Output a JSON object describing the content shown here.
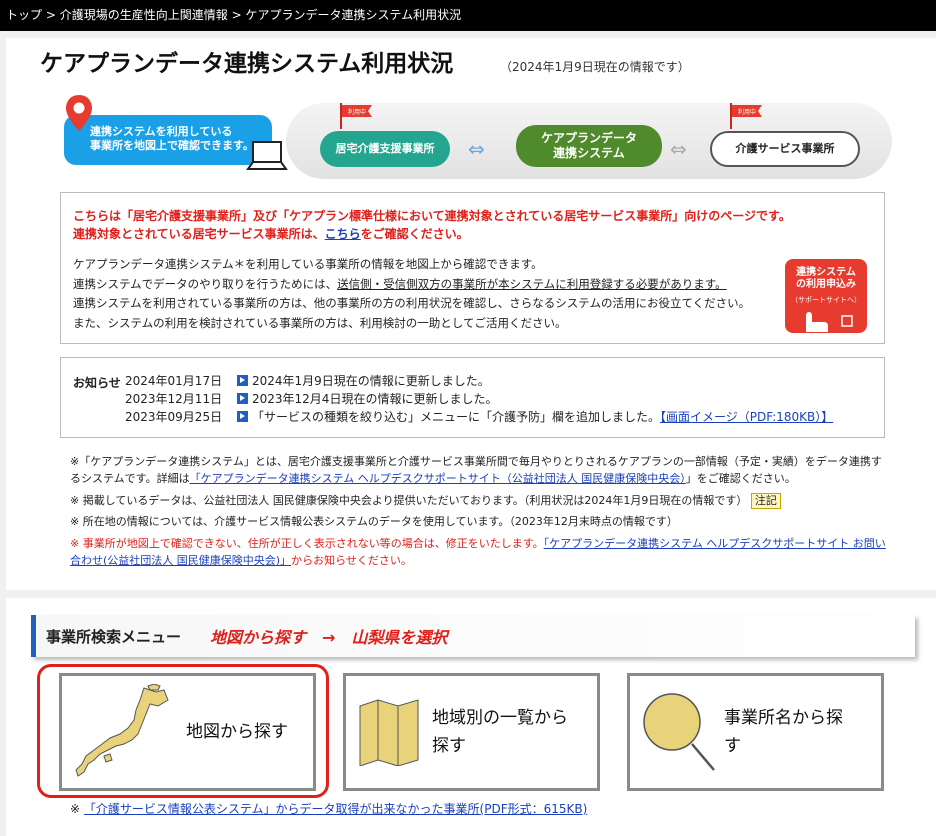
{
  "breadcrumb": {
    "items": [
      "トップ",
      "介護現場の生産性向上関連情報",
      "ケアプランデータ連携システム利用状況"
    ],
    "sep": ">"
  },
  "page": {
    "title": "ケアプランデータ連携システム利用状況",
    "as_of": "（2024年1月9日現在の情報です）"
  },
  "hero": {
    "map_text_line1": "連携システムを利用している",
    "map_text_line2": "事業所を地図上で確認できます。",
    "flag_label": "利用中",
    "node1": "居宅介護支援事業所",
    "node2_line1": "ケアプランデータ",
    "node2_line2": "連携システム",
    "node3": "介護サービス事業所",
    "arrow": "⇔"
  },
  "info": {
    "red_line1": "こちらは「居宅介護支援事業所」及び「ケアプラン標準仕様において連携対象とされている居宅サービス事業所」向けのページです。",
    "red_line2_pre": "連携対象とされている居宅サービス事業所は、",
    "red_line2_link": "こちら",
    "red_line2_post": "をご確認ください。",
    "desc1": "ケアプランデータ連携システム＊を利用している事業所の情報を地図上から確認できます。",
    "desc2_pre": "連携システムでデータのやり取りを行うためには、",
    "desc2_ul": "送信側・受信側双方の事業所が本システムに利用登録する必要があります。",
    "desc3": "連携システムを利用されている事業所の方は、他の事業所の方の利用状況を確認し、さらなるシステムの活用にお役立てください。",
    "desc4": "また、システムの利用を検討されている事業所の方は、利用検討の一助としてご活用ください。",
    "apply_line1": "連携システム",
    "apply_line2": "の利用申込み",
    "apply_sub": "（サポートサイトへ）",
    "accent": "#e63b2e"
  },
  "news": {
    "label": "お知らせ",
    "items": [
      {
        "date": "2024年01月17日",
        "text": "2024年1月9日現在の情報に更新しました。",
        "link": ""
      },
      {
        "date": "2023年12月11日",
        "text": "2023年12月4日現在の情報に更新しました。",
        "link": ""
      },
      {
        "date": "2023年09月25日",
        "text": "「サービスの種類を絞り込む」メニューに「介護予防」欄を追加しました。",
        "link": "【画面イメージ（PDF:180KB）】"
      }
    ]
  },
  "notes": {
    "n1_pre": "※「ケアプランデータ連携システム」とは、居宅介護支援事業所と介護サービス事業所間で毎月やりとりされるケアプランの一部情報（予定・実績）をデータ連携するシステムです。詳細は",
    "n1_link": "「ケアプランデータ連携システム ヘルプデスクサポートサイト（公益社団法人 国民健康保険中央会）",
    "n1_post": "」をご確認ください。",
    "n2": "※ 掲載しているデータは、公益社団法人 国民健康保険中央会より提供いただいております。（利用状況は2024年1月9日現在の情報です）",
    "n2_badge": "注記",
    "n3": "※ 所在地の情報については、介護サービス情報公表システムのデータを使用しています。（2023年12月末時点の情報です）",
    "n4_pre": "※ 事業所が地図上で確認できない、住所が正しく表示されない等の場合は、修正をいたします。",
    "n4_link": "「ケアプランデータ連携システム ヘルプデスクサポートサイト お問い合わせ(公益社団法人 国民健康保険中央会)」",
    "n4_post": "からお知らせください。"
  },
  "search_menu": {
    "title": "事業所検索メニュー",
    "hint": "地図から探す　→　山梨県を選択",
    "cards": [
      {
        "label": "地図から探す",
        "icon": "japan-map-icon"
      },
      {
        "label_line1": "地域別の一覧から",
        "label_line2": "探す",
        "icon": "folded-map-icon"
      },
      {
        "label_line1": "事業所名から探",
        "label_line2": "す",
        "icon": "magnifier-icon"
      }
    ],
    "foot_prefix": "※",
    "foot_link": "「介護サービス情報公表システム」からデータ取得が出来なかった事業所(PDF形式：615KB)"
  }
}
